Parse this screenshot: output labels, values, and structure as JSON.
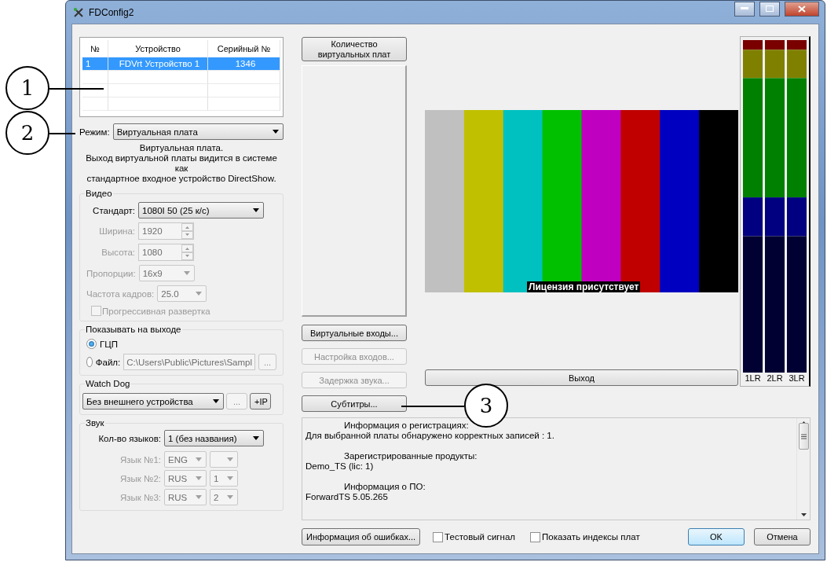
{
  "window": {
    "title": "FDConfig2"
  },
  "callouts": [
    {
      "number": "1"
    },
    {
      "number": "2"
    },
    {
      "number": "3"
    }
  ],
  "devices": {
    "columns": [
      "№",
      "Устройство",
      "Серийный №"
    ],
    "rows": [
      {
        "cells": [
          "1",
          "FDVrt Устройство 1",
          "1346"
        ],
        "selected": true
      }
    ]
  },
  "mode": {
    "label": "Режим:",
    "value": "Виртуальная плата",
    "description": [
      "Виртуальная плата.",
      "Выход виртуальной платы видится в системе как",
      "стандартное входное устройство DirectShow."
    ]
  },
  "video": {
    "title": "Видео",
    "fields": [
      {
        "kind": "combo",
        "label": "Стандарт:",
        "value": "1080I 50 (25 к/с)",
        "disabled": false
      },
      {
        "kind": "spin",
        "label": "Ширина:",
        "value": "1920",
        "disabled": true
      },
      {
        "kind": "spin",
        "label": "Высота:",
        "value": "1080",
        "disabled": true
      },
      {
        "kind": "combo",
        "label": "Пропорции:",
        "value": "16x9",
        "disabled": true
      },
      {
        "kind": "combo",
        "label": "Частота кадров:",
        "value": "25.0",
        "disabled": true
      }
    ],
    "progressive": {
      "label": "Прогрессивная развертка",
      "checked": false,
      "disabled": true
    }
  },
  "output": {
    "title": "Показывать на выходе",
    "options": [
      {
        "label": "ГЦП",
        "selected": true
      },
      {
        "label": "Файл:",
        "selected": false,
        "path": "C:\\Users\\Public\\Pictures\\Sampl",
        "browse": "..."
      }
    ]
  },
  "watchdog": {
    "title": "Watch Dog",
    "value": "Без внешнего устройства",
    "buttons": [
      {
        "label": "...",
        "disabled": true
      },
      {
        "label": "+IP",
        "disabled": false
      }
    ]
  },
  "sound": {
    "title": "Звук",
    "count_label": "Кол-во языков:",
    "count_value": "1 (без названия)",
    "languages": [
      {
        "label": "Язык №1:",
        "language": "ENG",
        "disabled": true
      },
      {
        "label": "Язык №2:",
        "language": "RUS",
        "index": "1",
        "disabled": true
      },
      {
        "label": "Язык №3:",
        "language": "RUS",
        "index": "2",
        "disabled": true
      }
    ]
  },
  "boards_button": {
    "label": "Количество виртуальных плат"
  },
  "side_buttons": [
    {
      "label": "Виртуальные входы...",
      "disabled": false
    },
    {
      "label": "Настройка входов...",
      "disabled": true
    },
    {
      "label": "Задержка звука...",
      "disabled": true
    },
    {
      "label": "Субтитры...",
      "disabled": false
    }
  ],
  "preview": {
    "caption": "Лицензия присутствует",
    "output_button": "Выход"
  },
  "meters": [
    {
      "label": "1LR"
    },
    {
      "label": "2LR"
    },
    {
      "label": "3LR"
    }
  ],
  "info": [
    {
      "heading": "Информация о регистрациях:",
      "value": "Для выбранной платы обнаружено корректных записей : 1."
    },
    {
      "heading": "Зарегистрированные продукты:",
      "value": "Demo_TS (lic: 1)"
    },
    {
      "heading": "Информация о ПО:",
      "value": "ForwardTS 5.05.265"
    }
  ],
  "footer": {
    "errors_button": "Информация об ошибках...",
    "checkboxes": [
      {
        "label": "Тестовый сигнал",
        "checked": false
      },
      {
        "label": "Показать индексы плат",
        "checked": false
      }
    ],
    "ok": "OK",
    "cancel": "Отмена"
  }
}
